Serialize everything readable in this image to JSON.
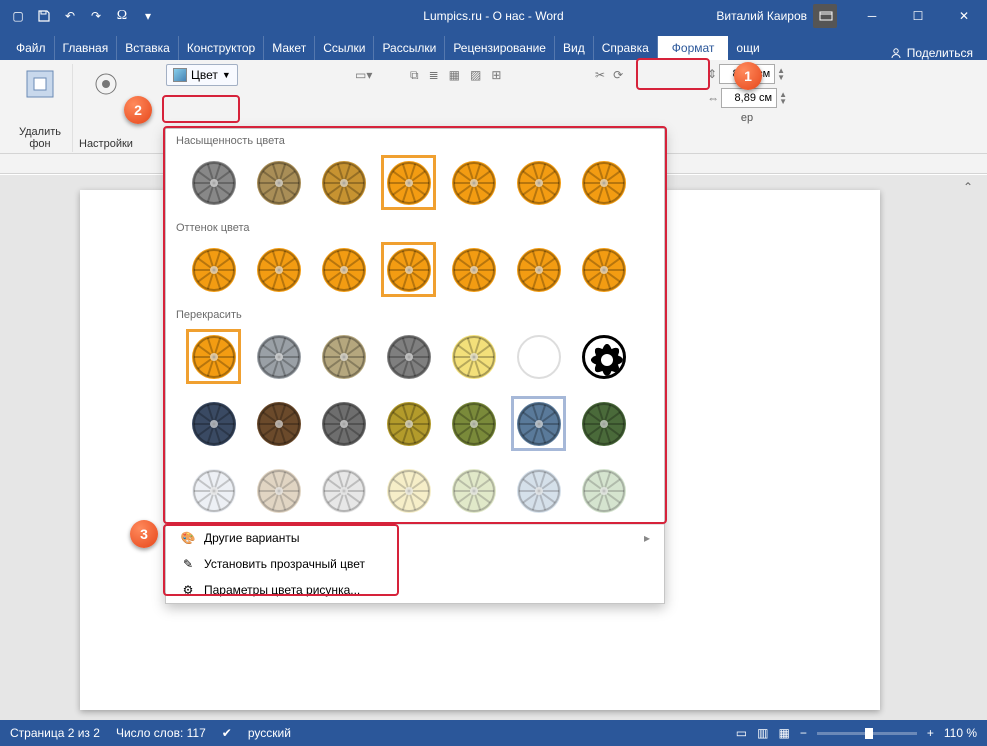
{
  "titlebar": {
    "app_title": "Lumpics.ru - О нас - Word",
    "user_name": "Виталий Каиров"
  },
  "tabs": {
    "items": [
      "Файл",
      "Главная",
      "Вставка",
      "Конструктор",
      "Макет",
      "Ссылки",
      "Рассылки",
      "Рецензирование",
      "Вид",
      "Справка",
      "Формат"
    ],
    "active": "Формат",
    "hidden_tail": "ощи",
    "share": "Поделиться"
  },
  "ribbon": {
    "remove_bg": "Удалить фон",
    "adjust": "Настройки",
    "color_btn": "Цвет",
    "size_w": "8,89 см",
    "size_h": "8,89 см",
    "size_unit_label": "ер"
  },
  "gallery": {
    "sec_saturation": "Насыщенность цвета",
    "sec_tone": "Оттенок цвета",
    "sec_recolor": "Перекрасить",
    "more_variants": "Другие варианты",
    "set_transparent": "Установить прозрачный цвет",
    "picture_color_options": "Параметры цвета рисунка...",
    "saturation_colors": [
      "#888888",
      "#a98e57",
      "#c79331",
      "#f39c12",
      "#f39c12",
      "#f39c12",
      "#f39c12"
    ],
    "tone_colors": [
      "#f39c12",
      "#f39c12",
      "#f39c12",
      "#f39c12",
      "#f39c12",
      "#f39c12",
      "#f39c12"
    ],
    "recolor_row1": [
      "#f39c12",
      "#9aa0a6",
      "#b5a77e",
      "#7f7f7f",
      "#f3e07a",
      "#ffffff",
      "#000000"
    ],
    "recolor_row2": [
      "#3a4a63",
      "#6b4a2b",
      "#6e6e6e",
      "#b39b2b",
      "#7a8a3a",
      "#5a7a9a",
      "#4a6a3a"
    ],
    "recolor_row3": [
      "#e8ecf2",
      "#d8c8b0",
      "#e0e0e0",
      "#f3e9b6",
      "#d8e2b8",
      "#c8d6e4",
      "#c8dcc0"
    ]
  },
  "statusbar": {
    "page": "Страница 2 из 2",
    "words": "Число слов: 117",
    "lang": "русский",
    "zoom": "110 %"
  },
  "callouts": {
    "c1": "1",
    "c2": "2",
    "c3": "3"
  }
}
